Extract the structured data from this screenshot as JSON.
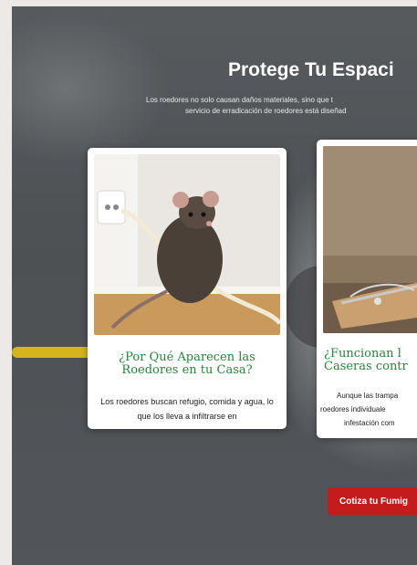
{
  "hero": {
    "title": "Protege Tu Espaci",
    "subtitle_line1": "Los roedores no solo causan daños materiales, sino que t",
    "subtitle_line2": "servicio de erradicación de roedores está diseñad"
  },
  "cards": [
    {
      "title": "¿Por Qué Aparecen las Roedores en tu Casa?",
      "text": "Los roedores buscan refugio, comida y agua, lo que los lleva a infiltrarse en"
    },
    {
      "title_line1": "¿Funcionan l",
      "title_line2": "Caseras contr",
      "text_line1": "Aunque las trampa",
      "text_line2": "roedores individuale",
      "text_line3": "infestación com"
    }
  ],
  "cta": {
    "label": "Cotiza tu Fumig"
  },
  "colors": {
    "accent_green": "#26843a",
    "cta_red": "#c41c1c"
  }
}
